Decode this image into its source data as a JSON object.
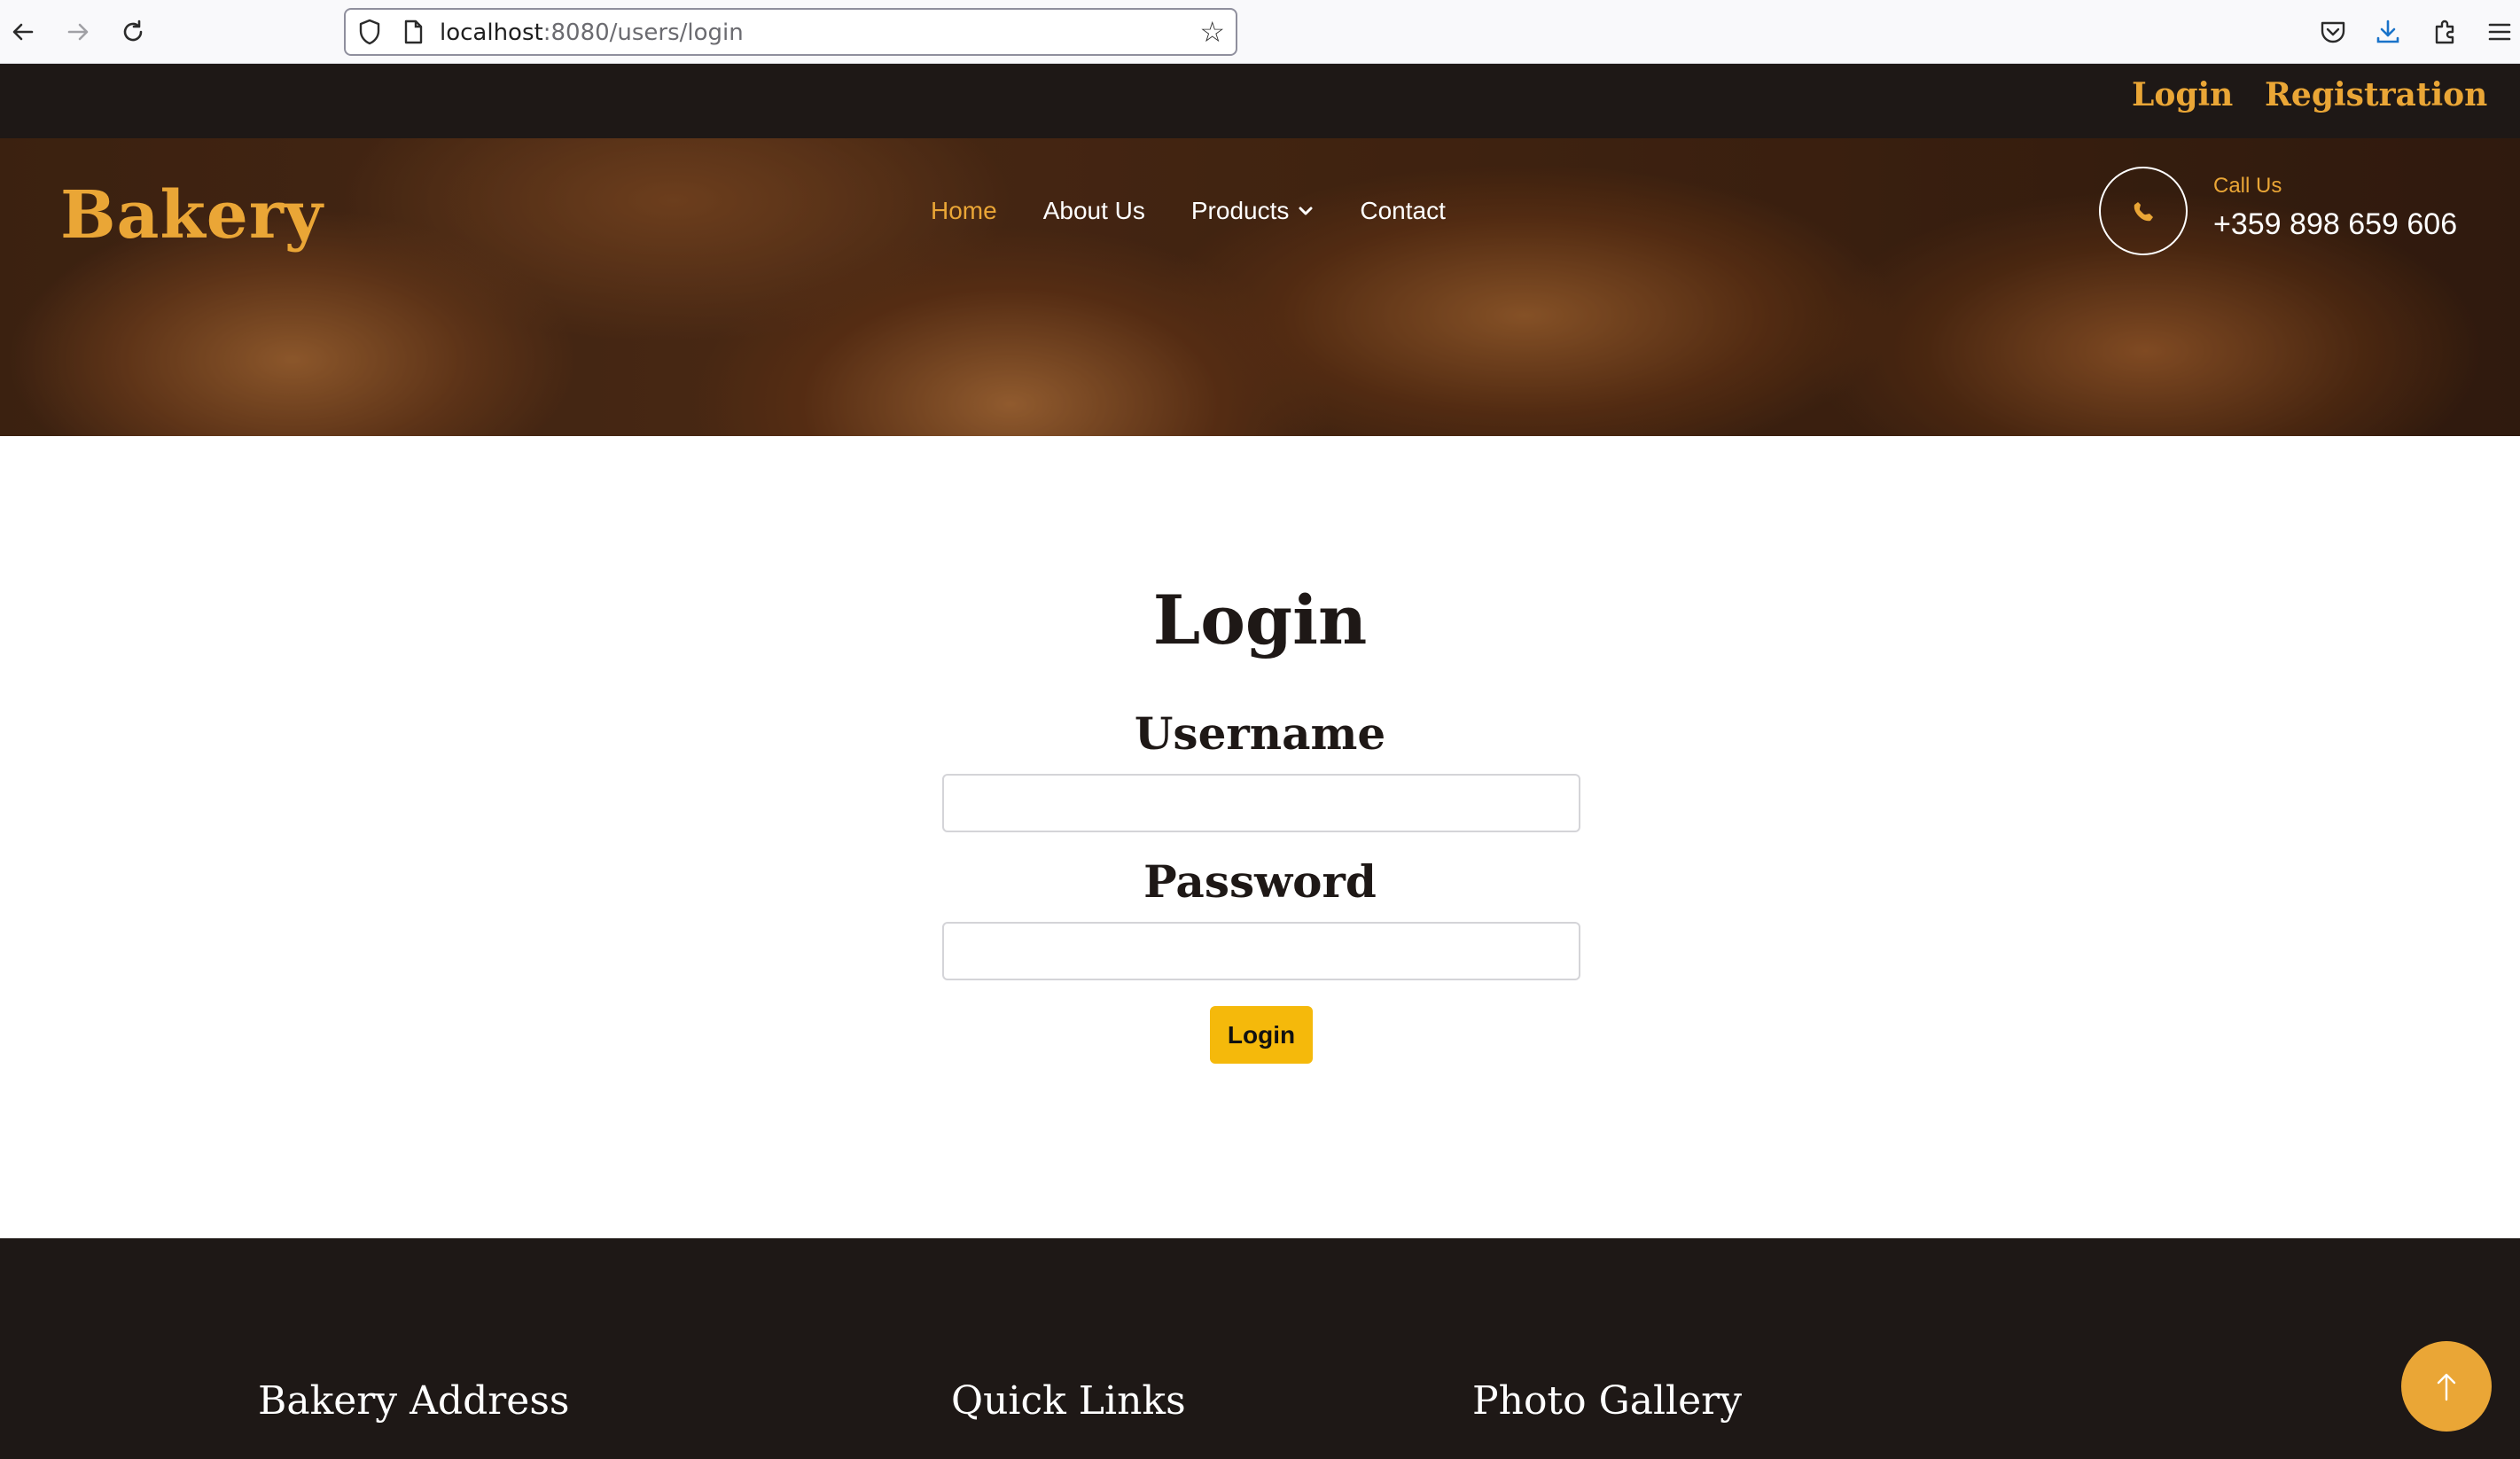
{
  "browser": {
    "url_host": "localhost",
    "url_path": ":8080/users/login",
    "back_icon": "arrow-left-icon",
    "forward_icon": "arrow-right-icon",
    "reload_icon": "reload-icon",
    "bookmark_icon": "star-icon",
    "pocket_icon": "pocket-icon",
    "downloads_icon": "download-icon",
    "extensions_icon": "puzzle-icon",
    "menu_icon": "hamburger-menu-icon"
  },
  "topbar": {
    "login_link": "Login",
    "registration_link": "Registration"
  },
  "header": {
    "logo": "Bakery",
    "nav": [
      {
        "label": "Home",
        "active": true
      },
      {
        "label": "About Us",
        "active": false
      },
      {
        "label": "Products",
        "active": false,
        "dropdown": true
      },
      {
        "label": "Contact",
        "active": false
      }
    ],
    "call_label": "Call Us",
    "phone": "+359 898 659 606"
  },
  "login_form": {
    "title": "Login",
    "username_label": "Username",
    "username_value": "",
    "password_label": "Password",
    "password_value": "",
    "submit_label": "Login"
  },
  "footer": {
    "address_heading": "Bakery Address",
    "links_heading": "Quick Links",
    "gallery_heading": "Photo Gallery"
  },
  "colors": {
    "accent": "#eaa636",
    "dark": "#1e1816",
    "button": "#f5b90b"
  }
}
